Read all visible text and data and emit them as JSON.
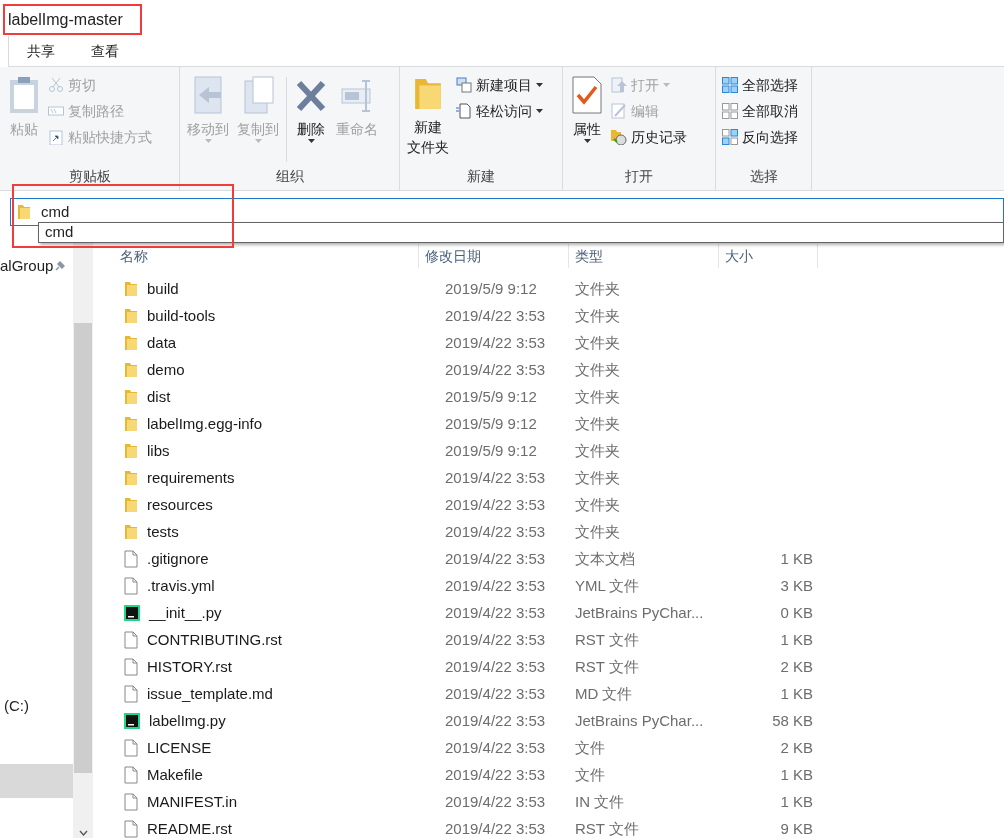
{
  "window": {
    "title": "labelImg-master"
  },
  "tabs": [
    {
      "label": "共享",
      "selected": false
    },
    {
      "label": "查看",
      "selected": false
    }
  ],
  "ribbon": {
    "groups": [
      {
        "label": "剪贴板",
        "large": [
          {
            "lines": [
              "粘贴"
            ],
            "disabled": true,
            "dropdown": false
          }
        ],
        "small": [
          {
            "label": "剪切",
            "disabled": true,
            "dropdown": false
          },
          {
            "label": "复制路径",
            "disabled": true,
            "dropdown": false
          },
          {
            "label": "粘贴快捷方式",
            "disabled": true,
            "dropdown": false
          }
        ]
      },
      {
        "label": "组织",
        "large": [
          {
            "lines": [
              "移动到"
            ],
            "disabled": true,
            "dropdown": true
          },
          {
            "lines": [
              "复制到"
            ],
            "disabled": true,
            "dropdown": true
          },
          {
            "lines": [
              "删除"
            ],
            "disabled": false,
            "dropdown": true
          },
          {
            "lines": [
              "重命名"
            ],
            "disabled": true,
            "dropdown": false
          }
        ]
      },
      {
        "label": "新建",
        "large": [
          {
            "lines": [
              "新建",
              "文件夹"
            ],
            "disabled": false,
            "dropdown": false
          }
        ],
        "small": [
          {
            "label": "新建项目",
            "disabled": false,
            "dropdown": true
          },
          {
            "label": "轻松访问",
            "disabled": false,
            "dropdown": true
          }
        ]
      },
      {
        "label": "打开",
        "large": [
          {
            "lines": [
              "属性"
            ],
            "disabled": false,
            "dropdown": true
          }
        ],
        "small": [
          {
            "label": "打开",
            "disabled": true,
            "dropdown": true
          },
          {
            "label": "编辑",
            "disabled": true,
            "dropdown": false
          },
          {
            "label": "历史记录",
            "disabled": false,
            "dropdown": false
          }
        ]
      },
      {
        "label": "选择",
        "small": [
          {
            "label": "全部选择",
            "disabled": false,
            "dropdown": false
          },
          {
            "label": "全部取消",
            "disabled": false,
            "dropdown": false
          },
          {
            "label": "反向选择",
            "disabled": false,
            "dropdown": false
          }
        ]
      }
    ]
  },
  "address_bar": {
    "value": "cmd",
    "suggestions": [
      "cmd"
    ]
  },
  "sidebar": {
    "items": [
      {
        "label": "alGroup",
        "pinned": true
      },
      {
        "label": "(C:)",
        "pinned": false
      }
    ]
  },
  "table": {
    "columns": [
      "名称",
      "修改日期",
      "类型",
      "大小"
    ],
    "rows": [
      {
        "kind": "folder",
        "name": "build",
        "date": "2019/5/9 9:12",
        "type": "文件夹"
      },
      {
        "kind": "folder",
        "name": "build-tools",
        "date": "2019/4/22 3:53",
        "type": "文件夹"
      },
      {
        "kind": "folder",
        "name": "data",
        "date": "2019/4/22 3:53",
        "type": "文件夹"
      },
      {
        "kind": "folder",
        "name": "demo",
        "date": "2019/4/22 3:53",
        "type": "文件夹"
      },
      {
        "kind": "folder",
        "name": "dist",
        "date": "2019/5/9 9:12",
        "type": "文件夹"
      },
      {
        "kind": "folder",
        "name": "labelImg.egg-info",
        "date": "2019/5/9 9:12",
        "type": "文件夹"
      },
      {
        "kind": "folder",
        "name": "libs",
        "date": "2019/5/9 9:12",
        "type": "文件夹"
      },
      {
        "kind": "folder",
        "name": "requirements",
        "date": "2019/4/22 3:53",
        "type": "文件夹"
      },
      {
        "kind": "folder",
        "name": "resources",
        "date": "2019/4/22 3:53",
        "type": "文件夹"
      },
      {
        "kind": "folder",
        "name": "tests",
        "date": "2019/4/22 3:53",
        "type": "文件夹"
      },
      {
        "kind": "file",
        "name": ".gitignore",
        "date": "2019/4/22 3:53",
        "type": "文本文档",
        "size": "1 KB"
      },
      {
        "kind": "file",
        "name": ".travis.yml",
        "date": "2019/4/22 3:53",
        "type": "YML 文件",
        "size": "3 KB"
      },
      {
        "kind": "python",
        "name": "__init__.py",
        "date": "2019/4/22 3:53",
        "type": "JetBrains PyChar...",
        "size": "0 KB"
      },
      {
        "kind": "file",
        "name": "CONTRIBUTING.rst",
        "date": "2019/4/22 3:53",
        "type": "RST 文件",
        "size": "1 KB"
      },
      {
        "kind": "file",
        "name": "HISTORY.rst",
        "date": "2019/4/22 3:53",
        "type": "RST 文件",
        "size": "2 KB"
      },
      {
        "kind": "file",
        "name": "issue_template.md",
        "date": "2019/4/22 3:53",
        "type": "MD 文件",
        "size": "1 KB"
      },
      {
        "kind": "python",
        "name": "labelImg.py",
        "date": "2019/4/22 3:53",
        "type": "JetBrains PyChar...",
        "size": "58 KB"
      },
      {
        "kind": "file",
        "name": "LICENSE",
        "date": "2019/4/22 3:53",
        "type": "文件",
        "size": "2 KB"
      },
      {
        "kind": "file",
        "name": "Makefile",
        "date": "2019/4/22 3:53",
        "type": "文件",
        "size": "1 KB"
      },
      {
        "kind": "file",
        "name": "MANIFEST.in",
        "date": "2019/4/22 3:53",
        "type": "IN 文件",
        "size": "1 KB"
      },
      {
        "kind": "file",
        "name": "README.rst",
        "date": "2019/4/22 3:53",
        "type": "RST 文件",
        "size": "9 KB"
      }
    ]
  }
}
